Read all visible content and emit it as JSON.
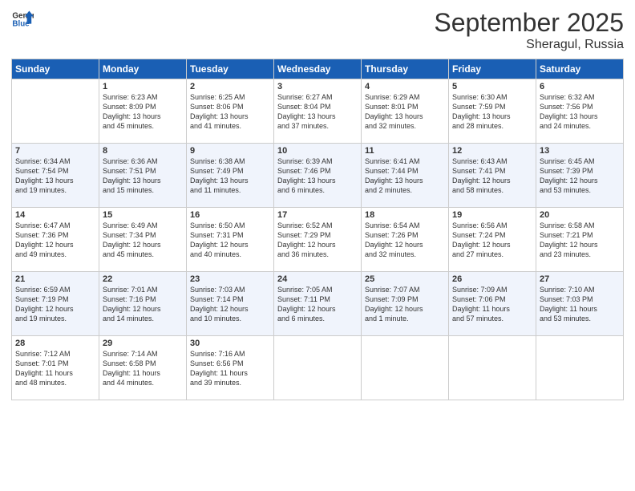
{
  "header": {
    "logo_line1": "General",
    "logo_line2": "Blue",
    "month": "September 2025",
    "location": "Sheragul, Russia"
  },
  "days_of_week": [
    "Sunday",
    "Monday",
    "Tuesday",
    "Wednesday",
    "Thursday",
    "Friday",
    "Saturday"
  ],
  "weeks": [
    [
      {
        "day": "",
        "info": ""
      },
      {
        "day": "1",
        "info": "Sunrise: 6:23 AM\nSunset: 8:09 PM\nDaylight: 13 hours\nand 45 minutes."
      },
      {
        "day": "2",
        "info": "Sunrise: 6:25 AM\nSunset: 8:06 PM\nDaylight: 13 hours\nand 41 minutes."
      },
      {
        "day": "3",
        "info": "Sunrise: 6:27 AM\nSunset: 8:04 PM\nDaylight: 13 hours\nand 37 minutes."
      },
      {
        "day": "4",
        "info": "Sunrise: 6:29 AM\nSunset: 8:01 PM\nDaylight: 13 hours\nand 32 minutes."
      },
      {
        "day": "5",
        "info": "Sunrise: 6:30 AM\nSunset: 7:59 PM\nDaylight: 13 hours\nand 28 minutes."
      },
      {
        "day": "6",
        "info": "Sunrise: 6:32 AM\nSunset: 7:56 PM\nDaylight: 13 hours\nand 24 minutes."
      }
    ],
    [
      {
        "day": "7",
        "info": "Sunrise: 6:34 AM\nSunset: 7:54 PM\nDaylight: 13 hours\nand 19 minutes."
      },
      {
        "day": "8",
        "info": "Sunrise: 6:36 AM\nSunset: 7:51 PM\nDaylight: 13 hours\nand 15 minutes."
      },
      {
        "day": "9",
        "info": "Sunrise: 6:38 AM\nSunset: 7:49 PM\nDaylight: 13 hours\nand 11 minutes."
      },
      {
        "day": "10",
        "info": "Sunrise: 6:39 AM\nSunset: 7:46 PM\nDaylight: 13 hours\nand 6 minutes."
      },
      {
        "day": "11",
        "info": "Sunrise: 6:41 AM\nSunset: 7:44 PM\nDaylight: 13 hours\nand 2 minutes."
      },
      {
        "day": "12",
        "info": "Sunrise: 6:43 AM\nSunset: 7:41 PM\nDaylight: 12 hours\nand 58 minutes."
      },
      {
        "day": "13",
        "info": "Sunrise: 6:45 AM\nSunset: 7:39 PM\nDaylight: 12 hours\nand 53 minutes."
      }
    ],
    [
      {
        "day": "14",
        "info": "Sunrise: 6:47 AM\nSunset: 7:36 PM\nDaylight: 12 hours\nand 49 minutes."
      },
      {
        "day": "15",
        "info": "Sunrise: 6:49 AM\nSunset: 7:34 PM\nDaylight: 12 hours\nand 45 minutes."
      },
      {
        "day": "16",
        "info": "Sunrise: 6:50 AM\nSunset: 7:31 PM\nDaylight: 12 hours\nand 40 minutes."
      },
      {
        "day": "17",
        "info": "Sunrise: 6:52 AM\nSunset: 7:29 PM\nDaylight: 12 hours\nand 36 minutes."
      },
      {
        "day": "18",
        "info": "Sunrise: 6:54 AM\nSunset: 7:26 PM\nDaylight: 12 hours\nand 32 minutes."
      },
      {
        "day": "19",
        "info": "Sunrise: 6:56 AM\nSunset: 7:24 PM\nDaylight: 12 hours\nand 27 minutes."
      },
      {
        "day": "20",
        "info": "Sunrise: 6:58 AM\nSunset: 7:21 PM\nDaylight: 12 hours\nand 23 minutes."
      }
    ],
    [
      {
        "day": "21",
        "info": "Sunrise: 6:59 AM\nSunset: 7:19 PM\nDaylight: 12 hours\nand 19 minutes."
      },
      {
        "day": "22",
        "info": "Sunrise: 7:01 AM\nSunset: 7:16 PM\nDaylight: 12 hours\nand 14 minutes."
      },
      {
        "day": "23",
        "info": "Sunrise: 7:03 AM\nSunset: 7:14 PM\nDaylight: 12 hours\nand 10 minutes."
      },
      {
        "day": "24",
        "info": "Sunrise: 7:05 AM\nSunset: 7:11 PM\nDaylight: 12 hours\nand 6 minutes."
      },
      {
        "day": "25",
        "info": "Sunrise: 7:07 AM\nSunset: 7:09 PM\nDaylight: 12 hours\nand 1 minute."
      },
      {
        "day": "26",
        "info": "Sunrise: 7:09 AM\nSunset: 7:06 PM\nDaylight: 11 hours\nand 57 minutes."
      },
      {
        "day": "27",
        "info": "Sunrise: 7:10 AM\nSunset: 7:03 PM\nDaylight: 11 hours\nand 53 minutes."
      }
    ],
    [
      {
        "day": "28",
        "info": "Sunrise: 7:12 AM\nSunset: 7:01 PM\nDaylight: 11 hours\nand 48 minutes."
      },
      {
        "day": "29",
        "info": "Sunrise: 7:14 AM\nSunset: 6:58 PM\nDaylight: 11 hours\nand 44 minutes."
      },
      {
        "day": "30",
        "info": "Sunrise: 7:16 AM\nSunset: 6:56 PM\nDaylight: 11 hours\nand 39 minutes."
      },
      {
        "day": "",
        "info": ""
      },
      {
        "day": "",
        "info": ""
      },
      {
        "day": "",
        "info": ""
      },
      {
        "day": "",
        "info": ""
      }
    ]
  ]
}
